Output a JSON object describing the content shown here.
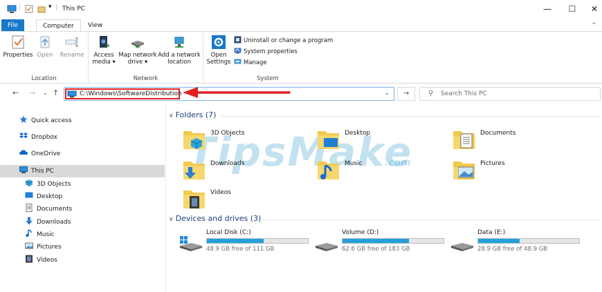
{
  "window": {
    "title": "This PC",
    "controls": {
      "minimize": "—",
      "maximize": "☐",
      "close": "✕"
    }
  },
  "tabs": [
    {
      "label": "File"
    },
    {
      "label": "Computer"
    },
    {
      "label": "View"
    }
  ],
  "ribbon": {
    "location": {
      "label": "Location",
      "buttons": [
        {
          "label": "Properties",
          "icon": "properties-icon"
        },
        {
          "label": "Open",
          "icon": "open-icon"
        },
        {
          "label": "Rename",
          "icon": "rename-icon"
        }
      ]
    },
    "network": {
      "label": "Network",
      "buttons": [
        {
          "label1": "Access",
          "label2": "media ▾",
          "icon": "access-media-icon"
        },
        {
          "label1": "Map network",
          "label2": "drive ▾",
          "icon": "map-network-drive-icon"
        },
        {
          "label1": "Add a network",
          "label2": "location",
          "icon": "add-network-location-icon"
        }
      ]
    },
    "system": {
      "label": "System",
      "open_settings1": "Open",
      "open_settings2": "Settings",
      "small": [
        {
          "label": "Uninstall or change a program",
          "icon": "uninstall-icon"
        },
        {
          "label": "System properties",
          "icon": "system-properties-icon"
        },
        {
          "label": "Manage",
          "icon": "manage-icon"
        }
      ]
    }
  },
  "address": {
    "path": "C:\\Windows\\SoftwareDistribution",
    "search_placeholder": "Search This PC"
  },
  "sidebar": [
    {
      "label": "Quick access",
      "icon": "star-icon"
    },
    {
      "label": "Dropbox",
      "icon": "dropbox-icon"
    },
    {
      "label": "OneDrive",
      "icon": "cloud-icon"
    },
    {
      "label": "This PC",
      "icon": "pc-icon",
      "selected": true
    },
    {
      "label": "3D Objects",
      "icon": "cube-icon"
    },
    {
      "label": "Desktop",
      "icon": "desktop-icon"
    },
    {
      "label": "Documents",
      "icon": "document-icon"
    },
    {
      "label": "Downloads",
      "icon": "download-icon"
    },
    {
      "label": "Music",
      "icon": "music-icon"
    },
    {
      "label": "Pictures",
      "icon": "picture-icon"
    },
    {
      "label": "Videos",
      "icon": "video-icon"
    }
  ],
  "folders_section": {
    "heading": "Folders (7)",
    "items": [
      {
        "label": "3D Objects"
      },
      {
        "label": "Desktop"
      },
      {
        "label": "Documents"
      },
      {
        "label": "Downloads"
      },
      {
        "label": "Music"
      },
      {
        "label": "Pictures"
      },
      {
        "label": "Videos"
      }
    ]
  },
  "drives_section": {
    "heading": "Devices and drives (3)",
    "items": [
      {
        "label": "Local Disk (C:)",
        "free": "48.9 GB free of 111 GB",
        "used_fraction": 0.56
      },
      {
        "label": "Volume (D:)",
        "free": "62.6 GB free of 183 GB",
        "used_fraction": 0.66
      },
      {
        "label": "Data (E:)",
        "free": "28.9 GB free of 48.9 GB",
        "used_fraction": 0.41
      }
    ]
  },
  "watermark": {
    "main": "TipsMake",
    "suffix": ".com"
  },
  "colors": {
    "accent": "#1979ca",
    "highlight_red": "#e02020",
    "drive_bar": "#26a0da"
  }
}
